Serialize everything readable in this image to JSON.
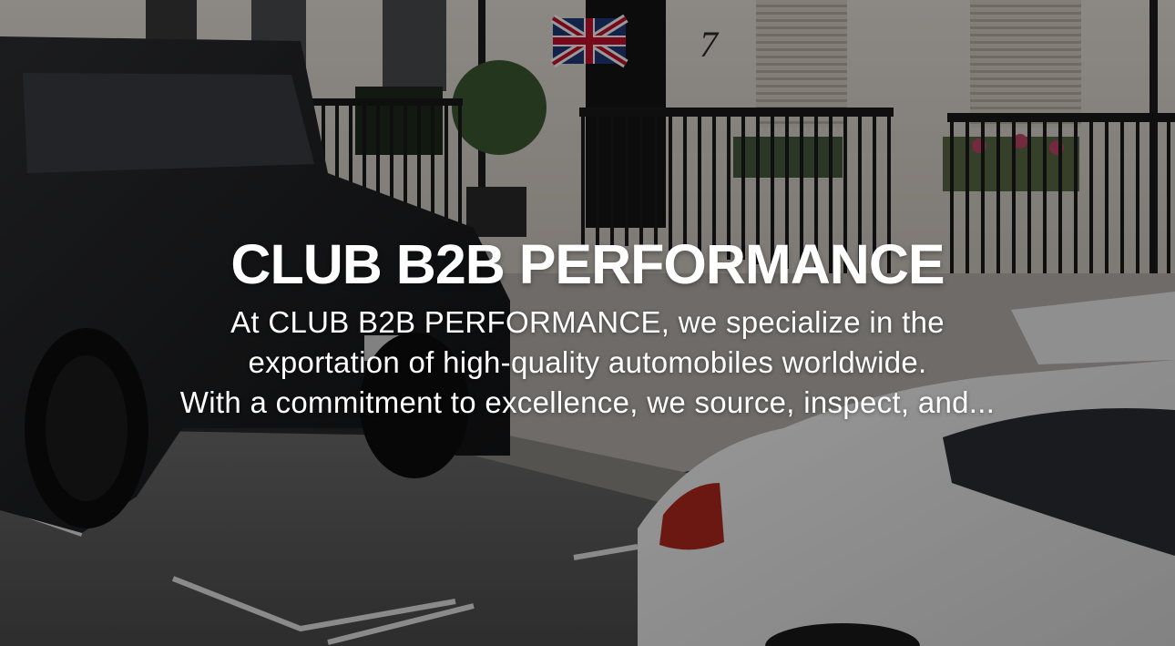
{
  "hero": {
    "title": "CLUB B2B PERFORMANCE",
    "description_lines": [
      "At CLUB B2B PERFORMANCE, we specialize in the",
      "exportation of high-quality automobiles worldwide.",
      "With a commitment to excellence, we source, inspect, and..."
    ],
    "door_number": "7",
    "overlay_color": "#000000"
  }
}
